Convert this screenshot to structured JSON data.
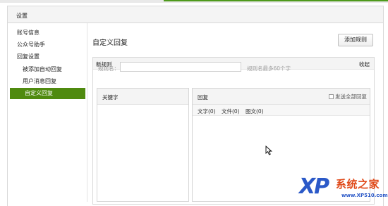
{
  "header": {
    "title": "设置"
  },
  "sidebar": {
    "items": [
      {
        "label": "账号信息",
        "level": 0,
        "active": false
      },
      {
        "label": "公众号助手",
        "level": 0,
        "active": false
      },
      {
        "label": "回复设置",
        "level": 0,
        "active": false
      },
      {
        "label": "被添加自动回复",
        "level": 1,
        "active": false
      },
      {
        "label": "用户消息回复",
        "level": 1,
        "active": false
      },
      {
        "label": "自定义回复",
        "level": 1,
        "active": true
      }
    ]
  },
  "main": {
    "title": "自定义回复",
    "add_button": "添加规则",
    "panel": {
      "title": "新规则",
      "collapse": "收起",
      "rule_name_label": "规则名：",
      "rule_name_value": "",
      "rule_name_hint": "规则名最多60个字",
      "keyword_title": "关键字",
      "reply_title": "回复",
      "send_all_label": "发送全部回复",
      "send_all_checked": false,
      "tabs": [
        "文字(0)",
        "文件(0)",
        "图文(0)"
      ]
    }
  },
  "watermark": {
    "brand": "系统之家",
    "xp": "XP",
    "url": "www.XP510.com"
  },
  "colors": {
    "accent": "#4f8a0f",
    "watermark_blue": "#2b59c8",
    "watermark_red": "#e04a1a"
  }
}
